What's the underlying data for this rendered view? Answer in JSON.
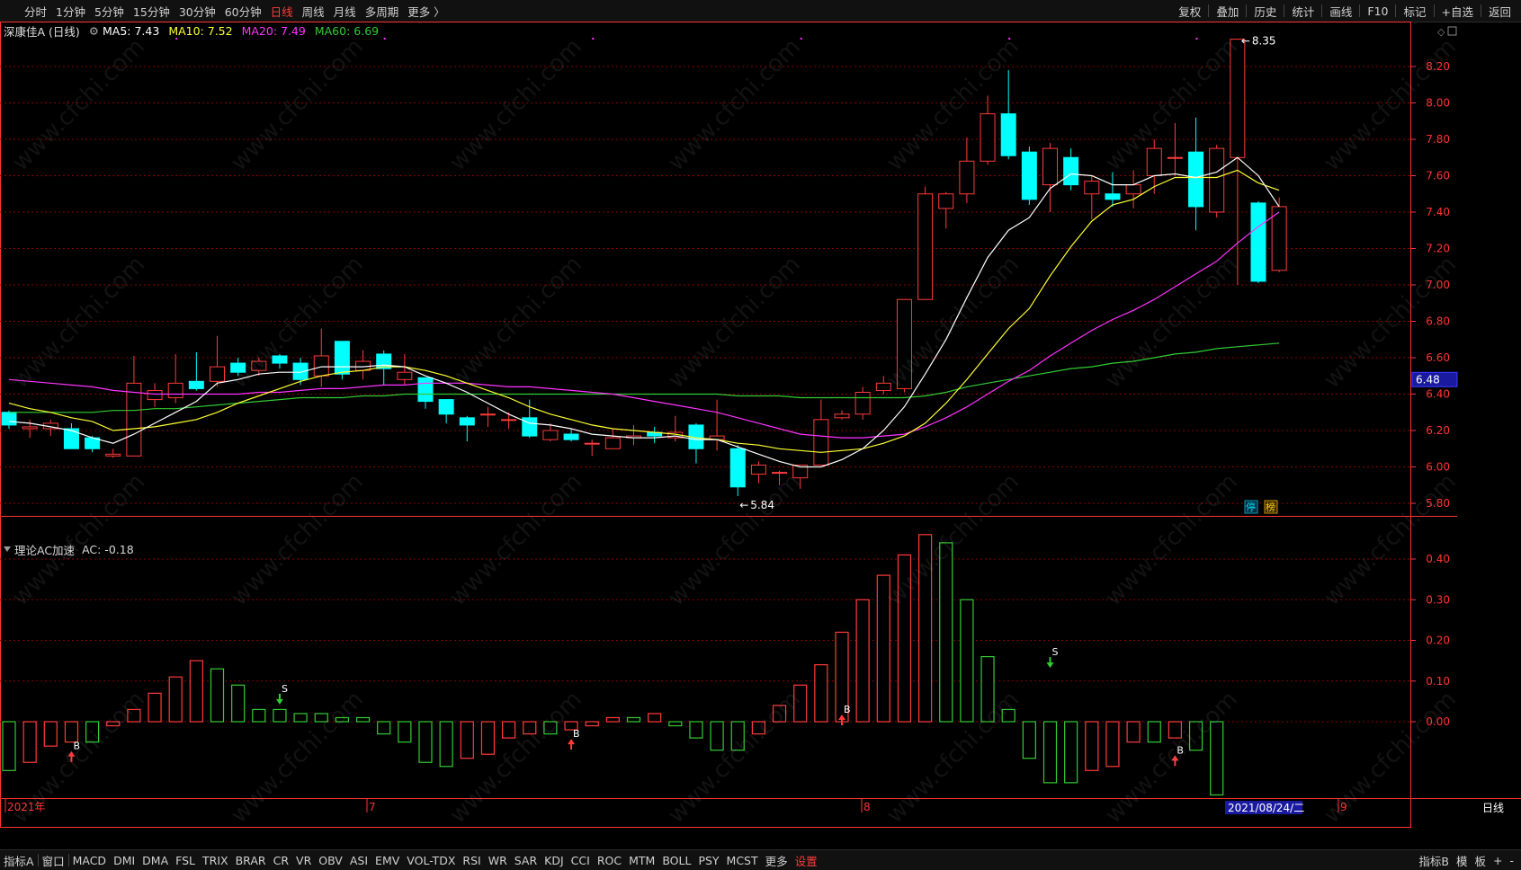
{
  "toolbar": {
    "periods": [
      "分时",
      "1分钟",
      "5分钟",
      "15分钟",
      "30分钟",
      "60分钟",
      "日线",
      "周线",
      "月线",
      "多周期",
      "更多 〉"
    ],
    "active_period": "日线",
    "right_items": [
      "复权",
      "叠加",
      "历史",
      "统计",
      "画线",
      "F10",
      "标记",
      "+自选",
      "返回"
    ]
  },
  "stock": {
    "title": "深康佳A (日线)",
    "ma5": "MA5: 7.43",
    "ma10": "MA10: 7.52",
    "ma20": "MA20: 7.49",
    "ma60": "MA60: 6.69"
  },
  "colors": {
    "up": "#ff3b3b",
    "down": "#00ffff",
    "ma5": "#ffffff",
    "ma10": "#ffff33",
    "ma20": "#ff33ff",
    "ma60": "#33cc33",
    "grid": "#8a0000",
    "axis": "#ff3333"
  },
  "price_axis": {
    "ticks": [
      "8.20",
      "8.00",
      "7.80",
      "7.60",
      "7.40",
      "7.20",
      "7.00",
      "6.80",
      "6.60",
      "6.40",
      "6.20",
      "6.00",
      "5.80"
    ],
    "current_price_label": "6.48",
    "high_label": "8.35",
    "low_label": "5.84"
  },
  "indicator": {
    "title": "理论AC加速",
    "value": "AC: -0.18",
    "ticks": [
      "0.40",
      "0.30",
      "0.20",
      "0.10",
      "0.00"
    ]
  },
  "date_axis": {
    "labels": [
      "2021年",
      "7",
      "8",
      "9"
    ],
    "cursor_date": "2021/08/24/二",
    "period_label": "日线"
  },
  "markers": {
    "buy": "B",
    "sell": "S",
    "badge1": "停",
    "badge2": "榜"
  },
  "bottom_tabs": [
    "指标A",
    "窗口",
    "MACD",
    "DMI",
    "DMA",
    "FSL",
    "TRIX",
    "BRAR",
    "CR",
    "VR",
    "OBV",
    "ASI",
    "EMV",
    "VOL-TDX",
    "RSI",
    "WR",
    "SAR",
    "KDJ",
    "CCI",
    "ROC",
    "MTM",
    "BOLL",
    "PSY",
    "MCST",
    "更多",
    "设置"
  ],
  "bottom_right": [
    "指标B",
    "模",
    "板",
    "+",
    "-"
  ],
  "watermark": "www.cfchi.com"
}
